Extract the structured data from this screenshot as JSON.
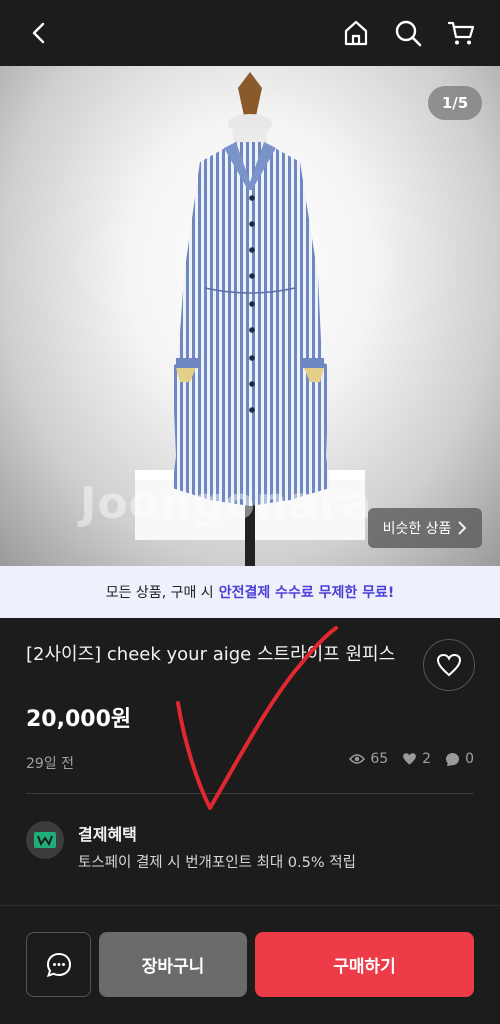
{
  "header": {
    "icons": [
      "back-arrow-icon",
      "home-icon",
      "search-icon",
      "cart-icon"
    ]
  },
  "gallery": {
    "counter": "1/5",
    "watermark": "Joongonara",
    "similar_label": "비슷한 상품"
  },
  "banner": {
    "prefix": "모든 상품, 구매 시",
    "highlight": "안전결제 수수료 무제한 무료!"
  },
  "product": {
    "title": "[2사이즈] cheek your aige 스트라이프 원피스",
    "price": "20,000원",
    "posted": "29일 전",
    "views": "65",
    "likes": "2",
    "chats": "0"
  },
  "benefit": {
    "title": "결제혜택",
    "description": "토스페이 결제 시 번개포인트 최대 0.5% 적립"
  },
  "actions": {
    "cart_label": "장바구니",
    "buy_label": "구매하기"
  },
  "colors": {
    "background": "#1c1c1c",
    "accent": "#ee3b48",
    "banner_highlight": "#4a3fd8"
  }
}
